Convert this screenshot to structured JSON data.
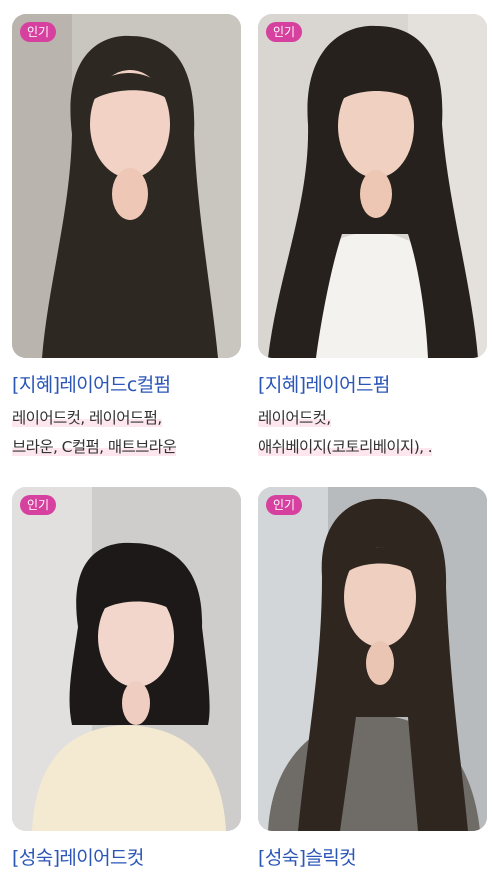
{
  "badge_label": "인기",
  "cards": [
    {
      "title": "[지혜]레이어드c컬펌",
      "tags_line1": "레이어드컷, 레이어드펌,",
      "tags_line2": "브라운, C컬펌, 매트브라운"
    },
    {
      "title": "[지혜]레이어드펌",
      "tags_line1": "레이어드컷,",
      "tags_line2": "애쉬베이지(코토리베이지), ."
    },
    {
      "title": "[성숙]레이어드컷"
    },
    {
      "title": "[성숙]슬릭컷"
    }
  ]
}
